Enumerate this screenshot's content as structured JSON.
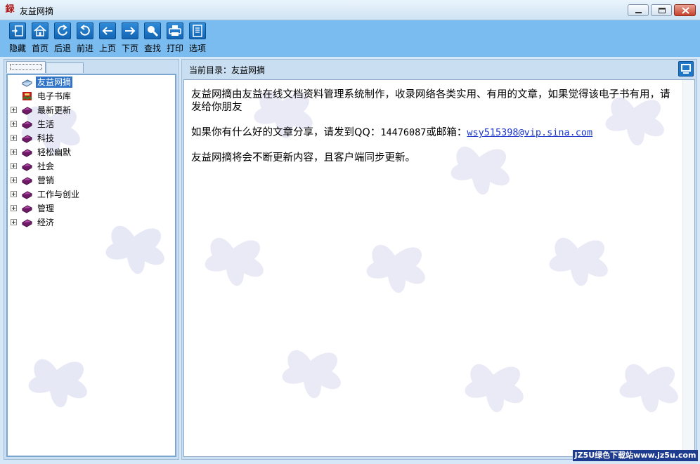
{
  "window": {
    "title": "友益网摘",
    "icon_char": "録"
  },
  "toolbar": {
    "buttons": [
      {
        "label": "隐藏",
        "icon": "hide-panel-icon"
      },
      {
        "label": "首页",
        "icon": "home-icon"
      },
      {
        "label": "后退",
        "icon": "back-refresh-icon"
      },
      {
        "label": "前进",
        "icon": "forward-refresh-icon"
      },
      {
        "label": "上页",
        "icon": "arrow-left-icon"
      },
      {
        "label": "下页",
        "icon": "arrow-right-icon"
      },
      {
        "label": "查找",
        "icon": "search-icon"
      },
      {
        "label": "打印",
        "icon": "print-icon"
      },
      {
        "label": "选项",
        "icon": "options-icon"
      }
    ]
  },
  "tree": {
    "items": [
      {
        "label": "友益网摘",
        "icon": "book-blue-icon",
        "selected": true,
        "expandable": false
      },
      {
        "label": "电子书库",
        "icon": "library-icon",
        "selected": false,
        "expandable": false
      },
      {
        "label": "最新更新",
        "icon": "book-purple-icon",
        "selected": false,
        "expandable": true
      },
      {
        "label": "生活",
        "icon": "book-purple-icon",
        "selected": false,
        "expandable": true
      },
      {
        "label": "科技",
        "icon": "book-purple-icon",
        "selected": false,
        "expandable": true
      },
      {
        "label": "轻松幽默",
        "icon": "book-purple-icon",
        "selected": false,
        "expandable": true
      },
      {
        "label": "社会",
        "icon": "book-purple-icon",
        "selected": false,
        "expandable": true
      },
      {
        "label": "营销",
        "icon": "book-purple-icon",
        "selected": false,
        "expandable": true
      },
      {
        "label": "工作与创业",
        "icon": "book-purple-icon",
        "selected": false,
        "expandable": true
      },
      {
        "label": "管理",
        "icon": "book-purple-icon",
        "selected": false,
        "expandable": true
      },
      {
        "label": "经济",
        "icon": "book-purple-icon",
        "selected": false,
        "expandable": true
      }
    ]
  },
  "pathbar": {
    "label": "当前目录：友益网摘"
  },
  "content": {
    "para1": "友益网摘由友益在线文档资料管理系统制作，收录网络各类实用、有用的文章，如果觉得该电子书有用，请发给你朋友",
    "para2_prefix": "如果你有什么好的文章分享，请发到QQ：",
    "qq": "14476087",
    "para2_mid": "或邮箱：",
    "email": "wsy515398@vip.sina.com",
    "para3": "友益网摘将会不断更新内容，且客户端同步更新。"
  },
  "watermark": "JZ5U绿色下载站www.jz5u.com",
  "colors": {
    "toolbar_bg": "#7bbcf0",
    "selection": "#2f74c8",
    "link": "#1a36c9",
    "book_purple": "#8a2a86"
  }
}
